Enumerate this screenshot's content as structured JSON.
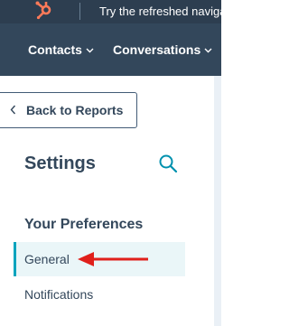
{
  "topbar": {
    "logo_icon": "hubspot-sprocket-icon",
    "promo_text": "Try the refreshed navigation"
  },
  "navbar": {
    "items": [
      {
        "label": "Contacts",
        "icon": "chevron-down-icon"
      },
      {
        "label": "Conversations",
        "icon": "chevron-down-icon"
      }
    ]
  },
  "sidebar": {
    "back_button": {
      "label": "Back to Reports",
      "icon": "chevron-left-icon"
    },
    "title": "Settings",
    "search_icon": "search-icon",
    "section_heading": "Your Preferences",
    "items": [
      {
        "label": "General",
        "active": true
      },
      {
        "label": "Notifications",
        "active": false
      }
    ],
    "annotation": "red-arrow-pointing-to-general"
  },
  "colors": {
    "topbar_bg": "#2d3e50",
    "navbar_bg": "#33475b",
    "brand_orange": "#ff7a59",
    "text": "#33475b",
    "active_accent": "#00a4bd",
    "active_bg": "#eaf6f8",
    "search_icon": "#0091ae",
    "annotation_red": "#e0201b"
  }
}
